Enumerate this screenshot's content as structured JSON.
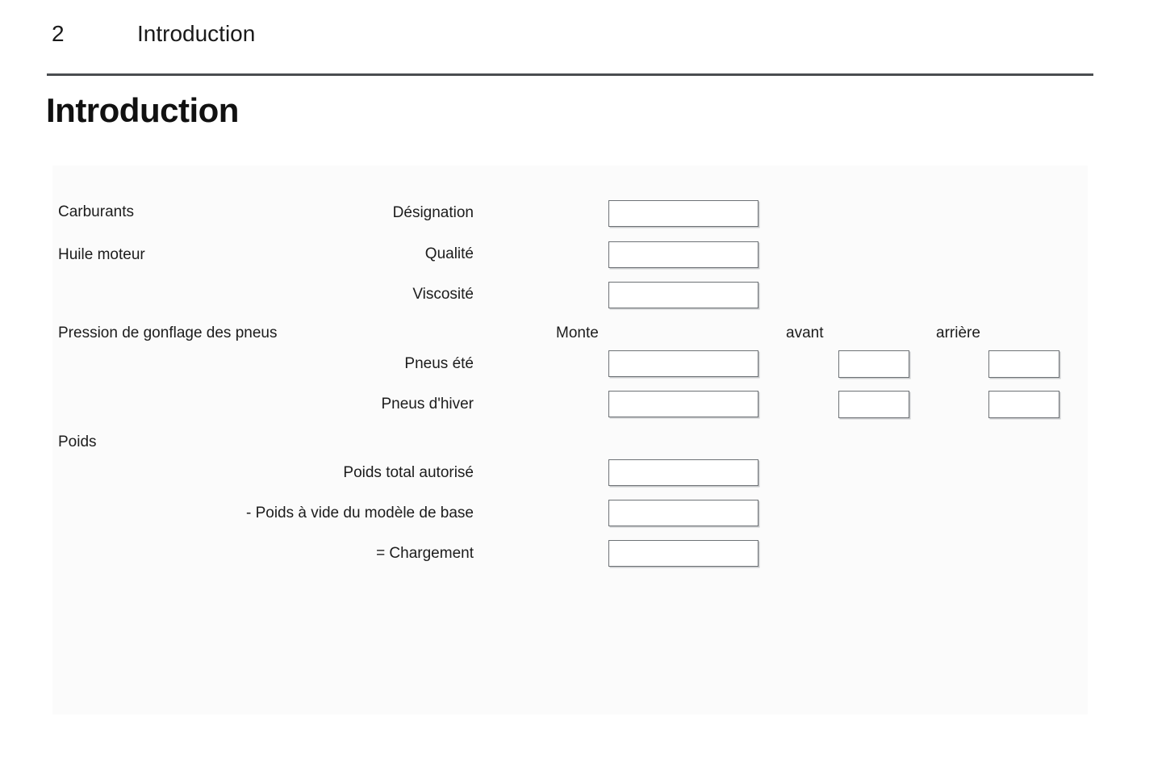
{
  "page": {
    "number": "2",
    "running_head": "Introduction",
    "section_title": "Introduction"
  },
  "colors": {
    "text": "#1a1a1a",
    "rule": "#4a4d50",
    "box_border": "#6e7276",
    "panel_background": "#fbfbfb"
  },
  "form": {
    "groups": [
      {
        "label": "Carburants"
      },
      {
        "label": "Huile moteur"
      },
      {
        "label": "Pression de gonflage des pneus"
      },
      {
        "label": "Poids"
      }
    ],
    "column_headers": {
      "monte": "Monte",
      "avant": "avant",
      "arriere": "arrière"
    },
    "fields": [
      {
        "label": "Désignation",
        "value": "",
        "placeholder": ""
      },
      {
        "label": "Qualité",
        "value": "",
        "placeholder": ""
      },
      {
        "label": "Viscosité",
        "value": "",
        "placeholder": ""
      },
      {
        "label": "Pneus été",
        "value": "",
        "placeholder": ""
      },
      {
        "label": "Pneus d'hiver",
        "value": "",
        "placeholder": ""
      },
      {
        "label": "Poids total autorisé",
        "value": "",
        "placeholder": ""
      },
      {
        "label": "- Poids à vide du modèle de base",
        "value": "",
        "placeholder": ""
      },
      {
        "label": "= Chargement",
        "value": "",
        "placeholder": ""
      }
    ]
  }
}
